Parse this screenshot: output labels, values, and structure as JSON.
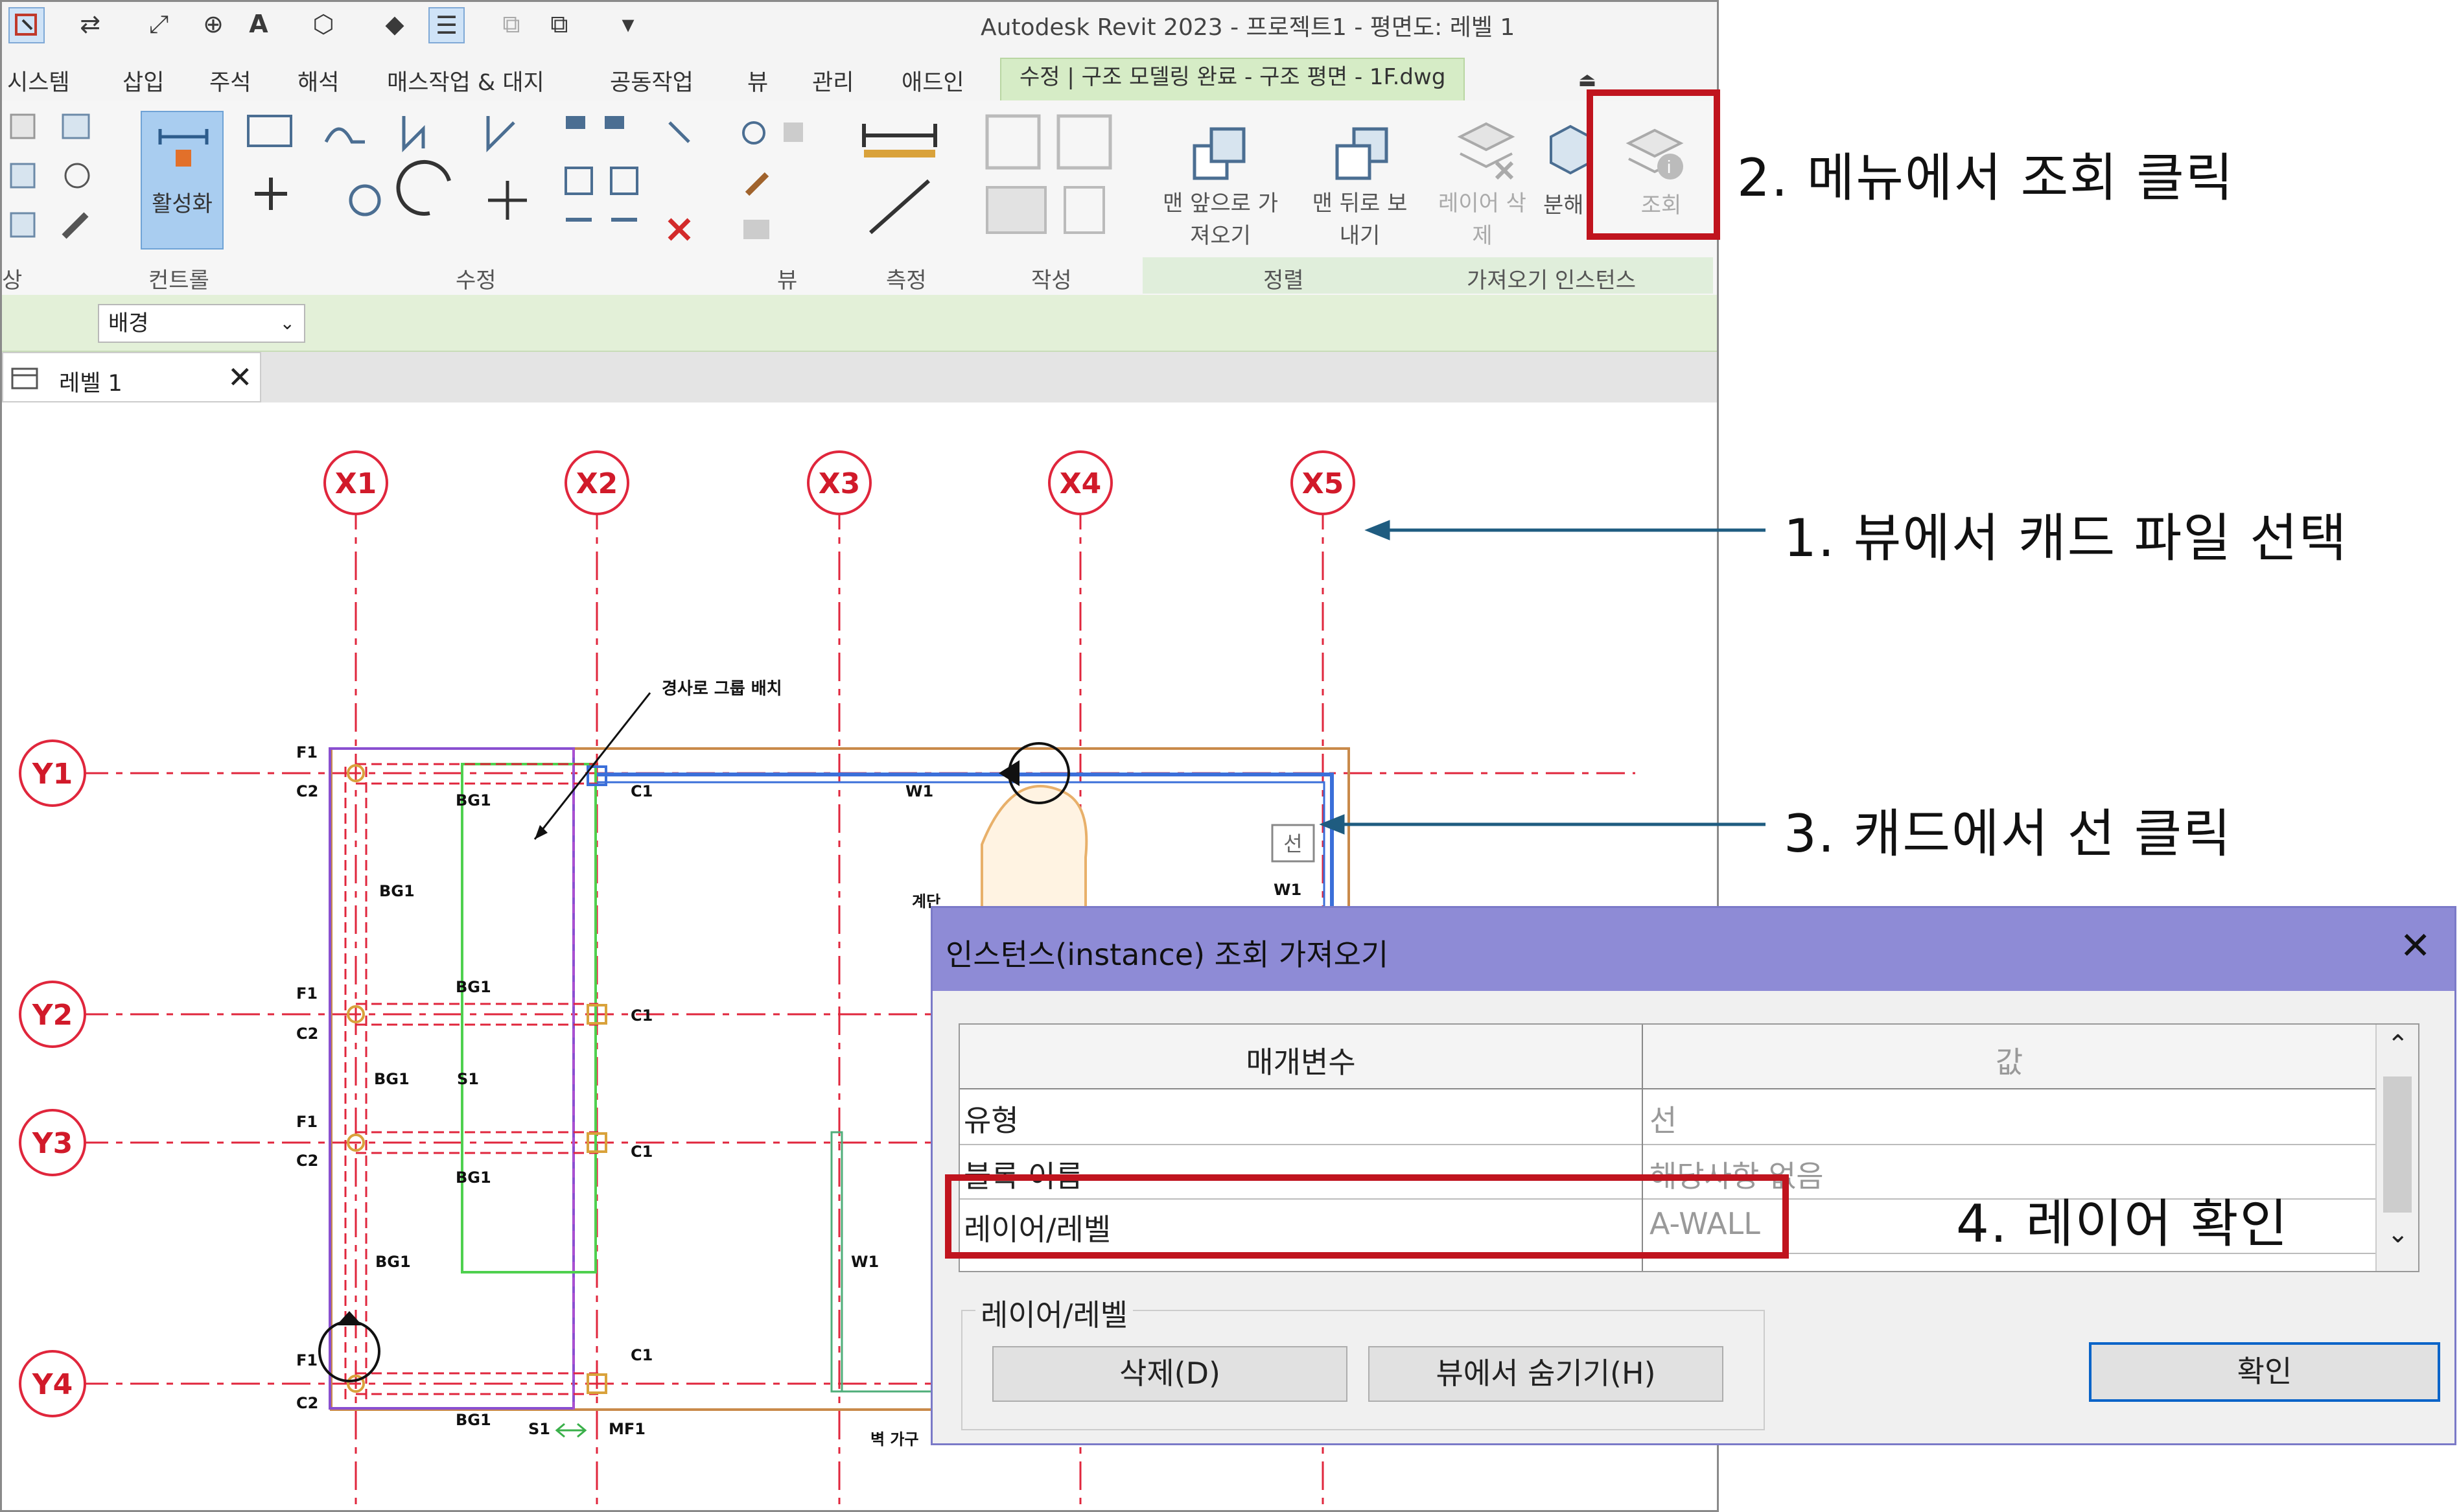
{
  "window": {
    "title": "Autodesk Revit 2023 - 프로젝트1 - 평면도: 레벨 1"
  },
  "tabs": [
    "시스템",
    "삽입",
    "주석",
    "해석",
    "매스작업 & 대지",
    "공동작업",
    "뷰",
    "관리",
    "애드인"
  ],
  "active_tab": "수정 | 구조 모델링 완료 - 구조 평면 - 1F.dwg",
  "ribbon": {
    "activate_label": "활성화",
    "bring_front_label": "맨 앞으로 가져오기",
    "send_back_label": "맨 뒤로 보내기",
    "delete_layer_label": "레이어 삭제",
    "explode_label": "분해",
    "query_label": "조회",
    "groups": [
      "상",
      "컨트롤",
      "수정",
      "뷰",
      "측정",
      "작성",
      "정렬",
      "가져오기 인스턴스"
    ]
  },
  "options_bar": {
    "combo_value": "배경"
  },
  "view_tab": {
    "label": "레벨 1"
  },
  "drawing": {
    "grid_x": [
      "X1",
      "X2",
      "X3",
      "X4",
      "X5"
    ],
    "grid_y": [
      "Y1",
      "Y2",
      "Y3",
      "Y4"
    ],
    "note_slope": "경사로 그룹 배치",
    "tag_line": "선",
    "label_stair": "계단",
    "label_wall_furniture": "벽 가구",
    "labels": {
      "f1": "F1",
      "c2": "C2",
      "c1": "C1",
      "bg1": "BG1",
      "w1": "W1",
      "s1": "S1",
      "mf1": "MF1"
    }
  },
  "dialog": {
    "title": "인스턴스(instance) 조회 가져오기",
    "col_param": "매개변수",
    "col_value": "값",
    "rows": [
      {
        "param": "유형",
        "value": "선"
      },
      {
        "param": "블록 이름",
        "value": "해당사항 없음"
      },
      {
        "param": "레이어/레벨",
        "value": "A-WALL"
      }
    ],
    "group_label": "레이어/레벨",
    "delete_button": "삭제(D)",
    "hide_button": "뷰에서 숨기기(H)",
    "ok_button": "확인"
  },
  "annotations": {
    "step1": "1. 뷰에서 캐드 파일 선택",
    "step2": "2. 메뉴에서 조회 클릭",
    "step3": "3. 캐드에서 선 클릭",
    "step4": "4. 레이어 확인"
  },
  "colors": {
    "highlight": "#c0141e",
    "grid": "#e0263c",
    "dialog_title": "#8e8bd6",
    "active_tab": "#d6ecc6",
    "annotation_arrow": "#1f5c80"
  }
}
